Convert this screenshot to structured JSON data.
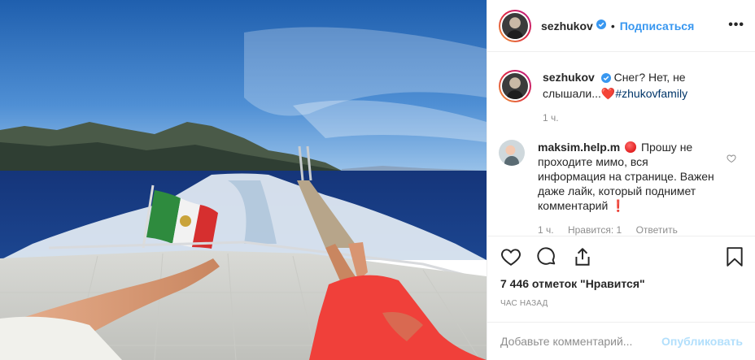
{
  "post": {
    "username": "sezhukov",
    "follow_label": "Подписаться",
    "dot": "•",
    "more_label": "•••"
  },
  "caption": {
    "username": "sezhukov",
    "text": "Снег? Нет, не слышали...",
    "heart": "❤️",
    "hashtag": "#zhukovfamily",
    "time": "1 ч."
  },
  "comment": {
    "username": "maksim.help.m",
    "text": "Прошу не проходите мимо, вся информация на странице. Важен даже лайк, который поднимет комментарий",
    "exclamation": "❗",
    "time": "1 ч.",
    "likes": "Нравится: 1",
    "reply": "Ответить"
  },
  "stats": {
    "likes": "7 446 отметок \"Нравится\"",
    "time_ago": "час назад"
  },
  "add_comment": {
    "placeholder": "Добавьте комментарий...",
    "publish": "Опубликовать"
  },
  "icons": [
    "verified-icon",
    "heart-icon",
    "comment-icon",
    "share-icon",
    "bookmark-icon"
  ],
  "colors": {
    "link": "#3897f0",
    "hashtag": "#003569",
    "muted": "#8e8e8e",
    "publish_disabled": "#b2dffc"
  }
}
